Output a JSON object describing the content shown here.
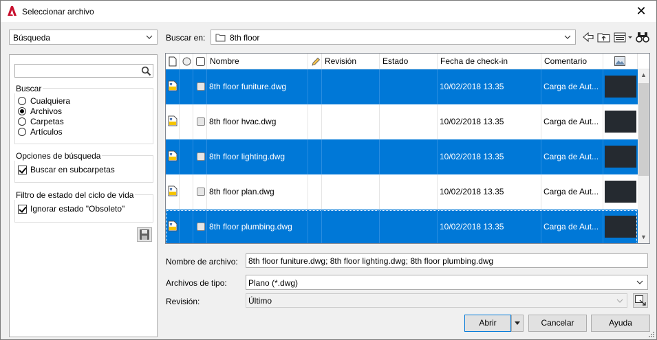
{
  "window": {
    "title": "Seleccionar archivo",
    "close_glyph": "✕"
  },
  "left": {
    "mode_select": "Búsqueda",
    "search": {
      "placeholder": "",
      "value": ""
    },
    "buscar_group": {
      "title": "Buscar",
      "options": [
        "Cualquiera",
        "Archivos",
        "Carpetas",
        "Artículos"
      ],
      "selected": "Archivos"
    },
    "opciones_group": {
      "title": "Opciones de búsqueda",
      "subfolders_label": "Buscar en subcarpetas",
      "subfolders_checked": true
    },
    "filtro_group": {
      "title": "Filtro de estado del ciclo de vida",
      "obsolete_label": "Ignorar estado \"Obsoleto\"",
      "obsolete_checked": true
    }
  },
  "toolbar": {
    "look_in_label": "Buscar en:",
    "look_in_value": "8th floor"
  },
  "columns": {
    "name": "Nombre",
    "revision": "Revisión",
    "state": "Estado",
    "checkin": "Fecha de check-in",
    "comment": "Comentario"
  },
  "files": [
    {
      "name": "8th floor funiture.dwg",
      "date": "10/02/2018 13.35",
      "comment": "Carga de Aut...",
      "selected": true
    },
    {
      "name": "8th floor hvac.dwg",
      "date": "10/02/2018 13.35",
      "comment": "Carga de Aut...",
      "selected": false
    },
    {
      "name": "8th floor lighting.dwg",
      "date": "10/02/2018 13.35",
      "comment": "Carga de Aut...",
      "selected": true
    },
    {
      "name": "8th floor plan.dwg",
      "date": "10/02/2018 13.35",
      "comment": "Carga de Aut...",
      "selected": false
    },
    {
      "name": "8th floor plumbing.dwg",
      "date": "10/02/2018 13.35",
      "comment": "Carga de Aut...",
      "selected": true
    }
  ],
  "bottom": {
    "filename_label": "Nombre de archivo:",
    "filename_value": "8th floor funiture.dwg; 8th floor lighting.dwg; 8th floor plumbing.dwg",
    "filetype_label": "Archivos de tipo:",
    "filetype_value": "Plano (*.dwg)",
    "revision_label": "Revisión:",
    "revision_value": "Último"
  },
  "buttons": {
    "open": "Abrir",
    "cancel": "Cancelar",
    "help": "Ayuda"
  },
  "colors": {
    "selection": "#0078d7",
    "brand_red": "#c8102e"
  }
}
